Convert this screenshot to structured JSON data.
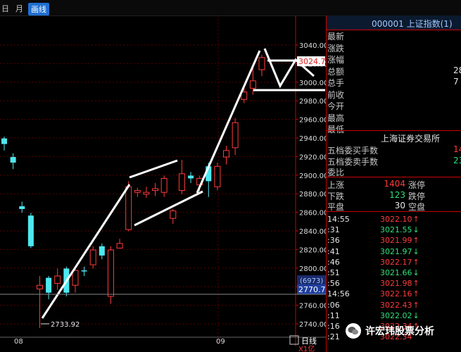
{
  "toolbar": {
    "item1": "日",
    "item2": "月",
    "period_active": "画线"
  },
  "chart_data": {
    "type": "candlestick",
    "ylim": [
      2730,
      3050
    ],
    "y_ticks": [
      3040,
      3020,
      3000,
      2980,
      2960,
      2940,
      2920,
      2900,
      2880,
      2860,
      2840,
      2820,
      2800,
      2780,
      2760,
      2740
    ],
    "x_tick_labels": [
      "08",
      "09"
    ],
    "annotations": {
      "low_label": "2733.92",
      "current_price_box": "3024.74",
      "vol_label": "(6973)",
      "vol_price": "2770.73",
      "bottom_tab": "日线",
      "bottom_left": "X1亿"
    },
    "candles": [
      {
        "o": 2932,
        "h": 2940,
        "l": 2925,
        "c": 2938,
        "up": false
      },
      {
        "o": 2918,
        "h": 2922,
        "l": 2905,
        "c": 2912,
        "up": false
      },
      {
        "o": 2865,
        "h": 2870,
        "l": 2858,
        "c": 2862,
        "up": false
      },
      {
        "o": 2855,
        "h": 2858,
        "l": 2820,
        "c": 2822,
        "up": false
      },
      {
        "o": 2780,
        "h": 2790,
        "l": 2734,
        "c": 2776,
        "up": true
      },
      {
        "o": 2772,
        "h": 2790,
        "l": 2765,
        "c": 2788,
        "up": false
      },
      {
        "o": 2782,
        "h": 2798,
        "l": 2775,
        "c": 2790,
        "up": true
      },
      {
        "o": 2772,
        "h": 2800,
        "l": 2768,
        "c": 2798,
        "up": false
      },
      {
        "o": 2780,
        "h": 2798,
        "l": 2772,
        "c": 2796,
        "up": true
      },
      {
        "o": 2795,
        "h": 2800,
        "l": 2790,
        "c": 2796,
        "up": false
      },
      {
        "o": 2802,
        "h": 2822,
        "l": 2798,
        "c": 2818,
        "up": true
      },
      {
        "o": 2812,
        "h": 2825,
        "l": 2808,
        "c": 2822,
        "up": false
      },
      {
        "o": 2818,
        "h": 2822,
        "l": 2760,
        "c": 2768,
        "up": true
      },
      {
        "o": 2825,
        "h": 2830,
        "l": 2820,
        "c": 2820,
        "up": true
      },
      {
        "o": 2840,
        "h": 2892,
        "l": 2838,
        "c": 2886,
        "up": true
      },
      {
        "o": 2880,
        "h": 2885,
        "l": 2875,
        "c": 2882,
        "up": true
      },
      {
        "o": 2878,
        "h": 2886,
        "l": 2874,
        "c": 2880,
        "up": true
      },
      {
        "o": 2882,
        "h": 2890,
        "l": 2876,
        "c": 2884,
        "up": true
      },
      {
        "o": 2880,
        "h": 2898,
        "l": 2875,
        "c": 2895,
        "up": true
      },
      {
        "o": 2852,
        "h": 2862,
        "l": 2846,
        "c": 2860,
        "up": true
      },
      {
        "o": 2882,
        "h": 2915,
        "l": 2878,
        "c": 2900,
        "up": true
      },
      {
        "o": 2898,
        "h": 2902,
        "l": 2890,
        "c": 2895,
        "up": false
      },
      {
        "o": 2888,
        "h": 2898,
        "l": 2880,
        "c": 2895,
        "up": true
      },
      {
        "o": 2892,
        "h": 2912,
        "l": 2875,
        "c": 2908,
        "up": false
      },
      {
        "o": 2886,
        "h": 2912,
        "l": 2882,
        "c": 2908,
        "up": true
      },
      {
        "o": 2918,
        "h": 2930,
        "l": 2910,
        "c": 2925,
        "up": true
      },
      {
        "o": 2928,
        "h": 2960,
        "l": 2920,
        "c": 2955,
        "up": true
      },
      {
        "o": 2980,
        "h": 2995,
        "l": 2976,
        "c": 2988,
        "up": true
      },
      {
        "o": 2992,
        "h": 3015,
        "l": 2985,
        "c": 3000,
        "up": true
      },
      {
        "o": 3012,
        "h": 3028,
        "l": 3005,
        "c": 3025,
        "up": true
      }
    ]
  },
  "panel": {
    "title": "000001 上证指数(1)",
    "labels": [
      "最新",
      "涨跌",
      "涨幅",
      "总额",
      "总手",
      "前收",
      "今开",
      "最高",
      "最低"
    ],
    "label_values": [
      "",
      "",
      "",
      "28",
      "7",
      "",
      "",
      "",
      ""
    ],
    "exchange": "上海证券交易所",
    "orders": [
      {
        "label": "五档委买手数",
        "value": "14"
      },
      {
        "label": "五档委卖手数",
        "value": "23"
      },
      {
        "label": "委比",
        "value": ""
      }
    ],
    "stats": [
      {
        "l1": "上涨",
        "v1": "1404",
        "l2": "涨停"
      },
      {
        "l1": "下跌",
        "v1": "123",
        "l2": "跌停"
      },
      {
        "l1": "平盘",
        "v1": "30",
        "l2": "空盘"
      }
    ],
    "ticks": [
      {
        "t": "14:55",
        "p": "3022.10",
        "a": "↑",
        "c": "red"
      },
      {
        "t": ":31",
        "p": "3021.55",
        "a": "↓",
        "c": "green"
      },
      {
        "t": ":36",
        "p": "3021.99",
        "a": "↑",
        "c": "red"
      },
      {
        "t": ":41",
        "p": "3021.97",
        "a": "↓",
        "c": "green"
      },
      {
        "t": ":46",
        "p": "3022.17",
        "a": "↑",
        "c": "red"
      },
      {
        "t": ":51",
        "p": "3021.66",
        "a": "↓",
        "c": "green"
      },
      {
        "t": ":56",
        "p": "3021.98",
        "a": "↑",
        "c": "red"
      },
      {
        "t": "14:56",
        "p": "3022.16",
        "a": "↑",
        "c": "red"
      },
      {
        "t": ":06",
        "p": "3022.43",
        "a": "↑",
        "c": "red"
      },
      {
        "t": ":11",
        "p": "3022.02",
        "a": "↓",
        "c": "green"
      },
      {
        "t": ":16",
        "p": "3022.34",
        "a": "↑",
        "c": "red"
      },
      {
        "t": ":21",
        "p": "3022.34",
        "a": "",
        "c": "red"
      }
    ]
  },
  "watermark": {
    "text": "许宏玮股票分析"
  }
}
